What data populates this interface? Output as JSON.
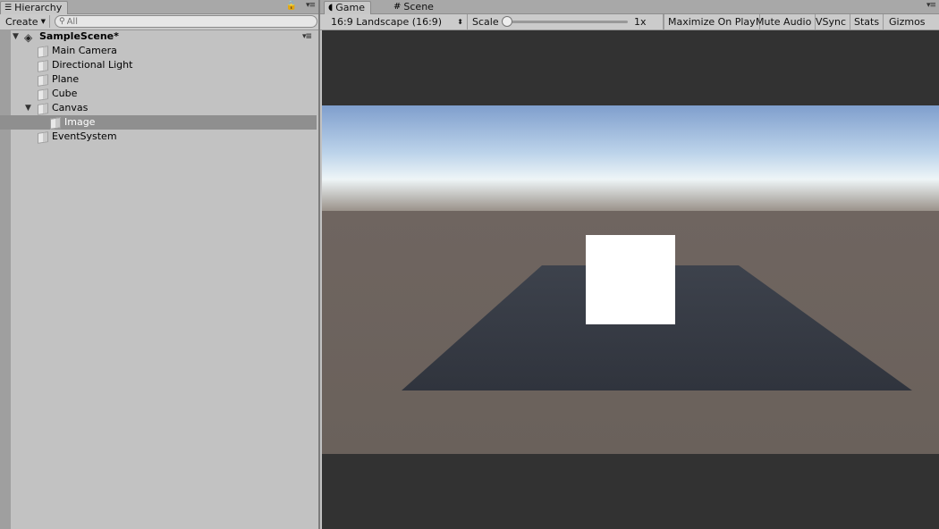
{
  "hierarchy": {
    "tab_label": "Hierarchy",
    "create_label": "Create",
    "search_placeholder": "All",
    "scene_name": "SampleScene*",
    "items": [
      {
        "label": "Main Camera"
      },
      {
        "label": "Directional Light"
      },
      {
        "label": "Plane"
      },
      {
        "label": "Cube"
      },
      {
        "label": "Canvas"
      },
      {
        "label": "Image"
      },
      {
        "label": "EventSystem"
      }
    ]
  },
  "game": {
    "tabs": [
      {
        "label": "Game",
        "icon": "pacman-icon"
      },
      {
        "label": "Scene",
        "icon": "grid-icon"
      }
    ],
    "aspect_label": "16:9 Landscape (16:9)",
    "scale_label": "Scale",
    "scale_value": "1x",
    "scale_slider": 0,
    "buttons": {
      "maximize": "Maximize On Play",
      "mute": "Mute Audio",
      "vsync": "VSync",
      "stats": "Stats",
      "gizmos": "Gizmos"
    }
  },
  "colors": {
    "panel": "#c2c2c2",
    "selection": "#8f8f8f",
    "viewport_bg": "#323232",
    "ground": "#6b625c",
    "plane": "#343841",
    "ui_image": "#ffffff"
  }
}
